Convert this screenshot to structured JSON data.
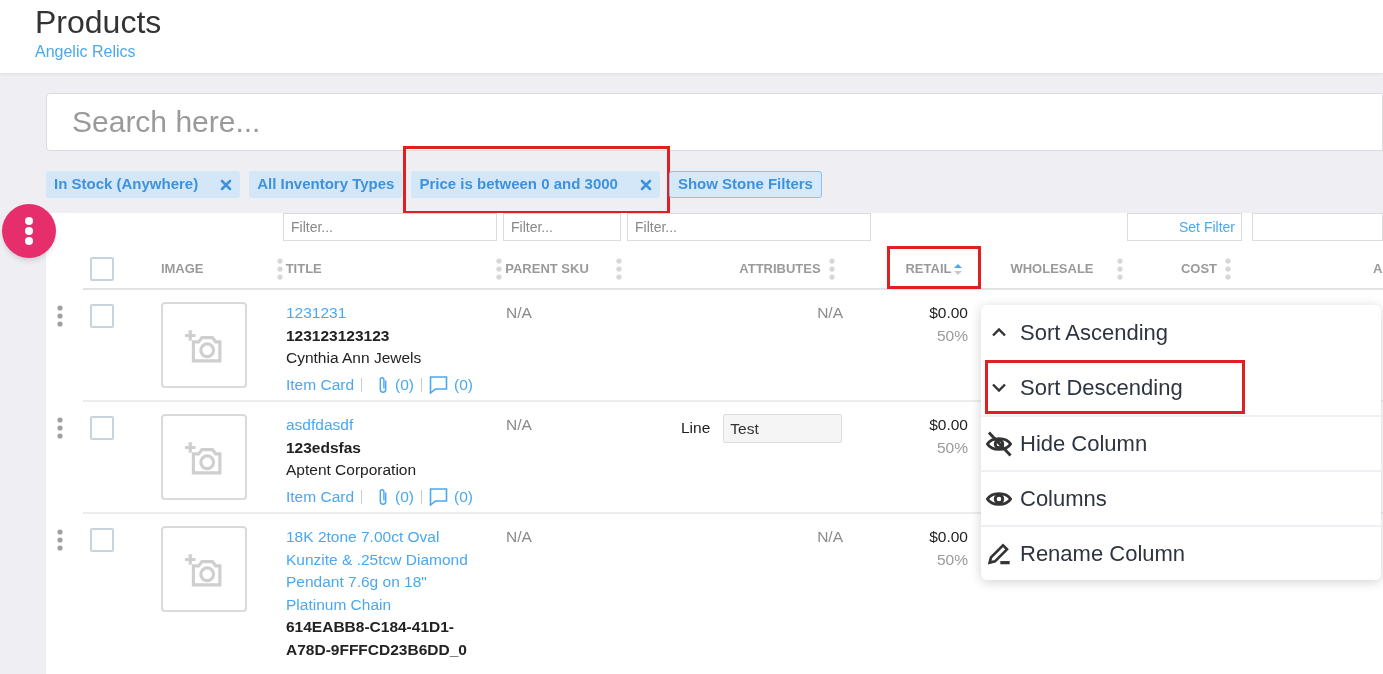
{
  "page": {
    "title": "Products",
    "subtitle": "Angelic Relics"
  },
  "search": {
    "placeholder": "Search here..."
  },
  "filter_chips": [
    {
      "kind": "chip",
      "label": "In Stock (Anywhere)",
      "removable": true,
      "highlighted": false
    },
    {
      "kind": "chip",
      "label": "All Inventory Types",
      "removable": false,
      "highlighted": false
    },
    {
      "kind": "chip",
      "label": "Price is between 0 and 3000",
      "removable": true,
      "highlighted": true
    },
    {
      "kind": "toggle",
      "label": "Show Stone Filters",
      "removable": false,
      "highlighted": false
    }
  ],
  "column_filters": [
    {
      "kind": "text",
      "placeholder": "Filter..."
    },
    {
      "kind": "text",
      "placeholder": "Filter..."
    },
    {
      "kind": "text",
      "placeholder": "Filter..."
    },
    {
      "kind": "button",
      "label": "Set Filter"
    },
    {
      "kind": "blank"
    }
  ],
  "table": {
    "select_all": {
      "checked": false
    },
    "columns": [
      {
        "label": "IMAGE",
        "sorted": false,
        "highlighted": false
      },
      {
        "label": "TITLE",
        "sorted": false,
        "highlighted": false
      },
      {
        "label": "PARENT SKU",
        "sorted": false,
        "highlighted": false
      },
      {
        "label": "ATTRIBUTES",
        "sorted": false,
        "highlighted": false
      },
      {
        "label": "RETAIL",
        "sorted": true,
        "highlighted": true
      },
      {
        "label": "WHOLESALE",
        "sorted": false,
        "highlighted": false
      },
      {
        "label": "COST",
        "sorted": false,
        "highlighted": false
      },
      {
        "label": "A",
        "highlighted": false
      }
    ],
    "rows": [
      {
        "checked": false,
        "title": "1231231",
        "sku": "123123123123",
        "vendor": "Cynthia Ann Jewels",
        "links": {
          "item_card": "Item Card",
          "attachments": "(0)",
          "comments": "(0)"
        },
        "parent_sku": "N/A",
        "attributes": {
          "kind": "text",
          "value": "N/A"
        },
        "retail": "$0.00",
        "markup": "50%"
      },
      {
        "checked": false,
        "title": "asdfdasdf",
        "sku": "123edsfas",
        "vendor": "Aptent Corporation",
        "links": {
          "item_card": "Item Card",
          "attachments": "(0)",
          "comments": "(0)"
        },
        "parent_sku": "N/A",
        "attributes": {
          "kind": "field",
          "label": "Line",
          "value": "Test"
        },
        "retail": "$0.00",
        "markup": "50%"
      },
      {
        "checked": false,
        "title": "18K 2tone 7.00ct Oval Kunzite & .25tcw Diamond Pendant 7.6g on 18\" Platinum Chain",
        "sku": "614EABB8-C184-41D1-A78D-9FFFCD23B6DD_0",
        "parent_sku": "N/A",
        "attributes": {
          "kind": "text",
          "value": "N/A"
        },
        "retail": "$0.00",
        "markup": "50%"
      }
    ]
  },
  "column_menu": {
    "items": [
      {
        "kind": "sort-ascending",
        "label": "Sort Ascending",
        "highlighted": false
      },
      {
        "kind": "sort-descending",
        "label": "Sort Descending",
        "highlighted": true
      },
      {
        "kind": "hide",
        "label": "Hide Column",
        "highlighted": false
      },
      {
        "kind": "columns",
        "label": "Columns",
        "highlighted": false
      },
      {
        "kind": "rename",
        "label": "Rename Column",
        "highlighted": false
      }
    ]
  }
}
